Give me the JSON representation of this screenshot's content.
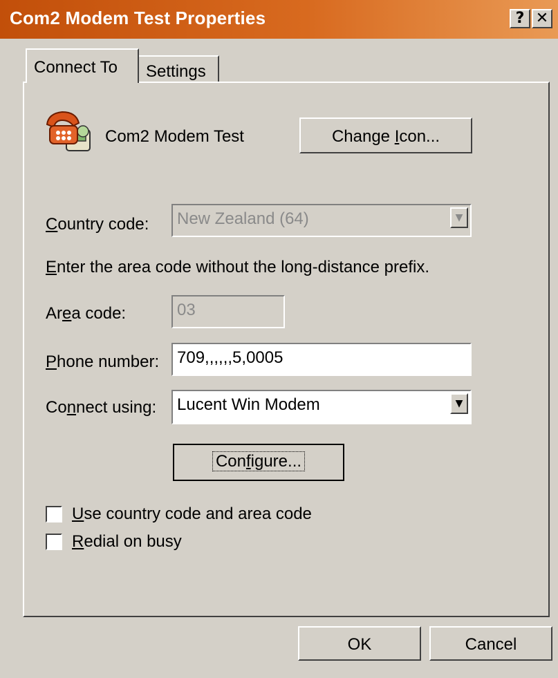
{
  "window": {
    "title": "Com2 Modem Test Properties",
    "help_glyph": "?",
    "close_glyph": "✕"
  },
  "tabs": [
    {
      "label": "Connect To",
      "active": true
    },
    {
      "label": "Settings",
      "active": false
    }
  ],
  "connection": {
    "name": "Com2 Modem Test",
    "icon": "phone-modem-icon",
    "change_icon_prefix": "Change ",
    "change_icon_mnemonic": "I",
    "change_icon_suffix": "con..."
  },
  "country": {
    "label_mnemonic": "C",
    "label_rest": "ountry code:",
    "value": "New Zealand (64)",
    "enabled": false
  },
  "instruction_prefix": "E",
  "instruction_rest": "nter the area code without the long-distance prefix.",
  "area_code": {
    "label_prefix": "Ar",
    "label_mnemonic": "e",
    "label_rest": "a code:",
    "value": "03",
    "enabled": false
  },
  "phone": {
    "label_mnemonic": "P",
    "label_rest": "hone number:",
    "value": "709,,,,,,5,0005"
  },
  "connect_using": {
    "label_prefix": "Co",
    "label_mnemonic": "n",
    "label_rest": "nect using:",
    "value": "Lucent Win Modem"
  },
  "configure": {
    "prefix": "Con",
    "mnemonic": "f",
    "suffix": "igure..."
  },
  "options": {
    "use_country_code": {
      "mnemonic": "U",
      "rest": "se country code and area code",
      "checked": false
    },
    "redial": {
      "mnemonic": "R",
      "rest": "edial on busy",
      "checked": false
    }
  },
  "buttons": {
    "ok": "OK",
    "cancel": "Cancel"
  },
  "colors": {
    "dialog_face": "#d4d0c8",
    "title_gradient_start": "#c24f0a",
    "title_gradient_end": "#e99a55"
  }
}
